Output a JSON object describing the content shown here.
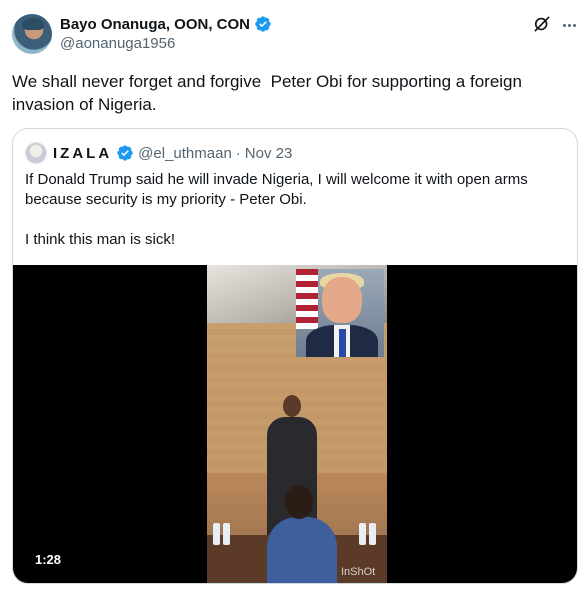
{
  "author": {
    "display_name": "Bayo Onanuga, OON, CON",
    "handle": "@aonanuga1956",
    "verified_color": "#1d9bf0",
    "icons": [
      "verified-badge-icon",
      "grok-icon",
      "more-options-icon"
    ]
  },
  "tweet": {
    "text": "We shall never forget and forgive  Peter Obi for supporting a foreign invasion of Nigeria."
  },
  "quoted": {
    "display_name": "IZALA",
    "handle": "@el_uthmaan",
    "separator": "·",
    "date": "Nov 23",
    "text": "If Donald Trump said he will invade Nigeria, I will welcome it with open arms because security is my priority - Peter Obi.\n\nI think this man is sick!",
    "video": {
      "duration": "1:28",
      "watermark": "InShOt"
    }
  }
}
